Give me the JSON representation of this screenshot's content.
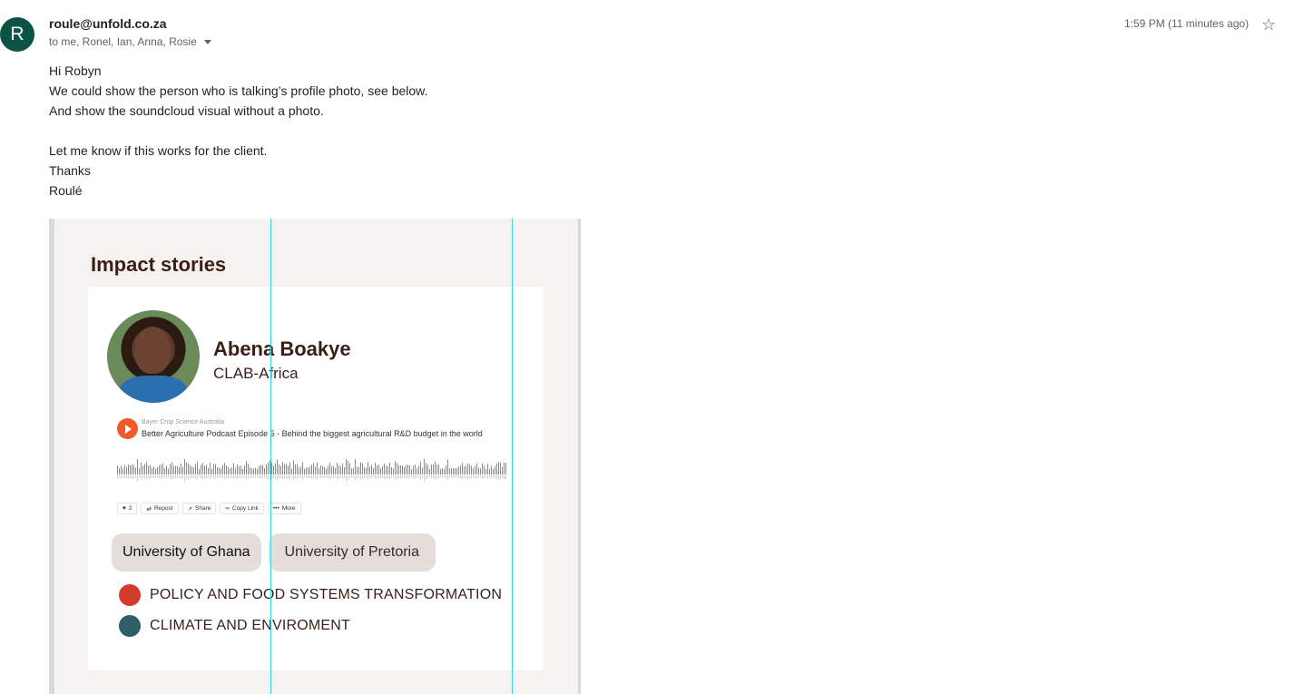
{
  "email": {
    "sender_initial": "R",
    "sender": "roule@unfold.co.za",
    "recipients": "to me, Ronel, Ian, Anna, Rosie",
    "timestamp": "1:59 PM (11 minutes ago)",
    "body_lines": [
      "Hi Robyn",
      "We could show the person who is talking’s profile photo, see below.",
      "And show the soundcloud visual without a photo.",
      "",
      "Let me know if this works for the client.",
      "Thanks",
      "Roulé"
    ]
  },
  "embed": {
    "title": "Impact stories",
    "person_name": "Abena Boakye",
    "person_org": "CLAB-Africa",
    "soundcloud": {
      "artist": "Bayer Crop Science Australia",
      "track": "Better Agriculture Podcast Episode 5 - Behind the biggest agricultural R&D budget in the world",
      "like_count": "2",
      "buttons": [
        "Repost",
        "Share",
        "Copy Link",
        "More"
      ]
    },
    "universities": [
      "University of Ghana",
      "University of Pretoria"
    ],
    "tags": [
      {
        "label": "POLICY AND FOOD SYSTEMS TRANSFORMATION",
        "color": "#d33a2c"
      },
      {
        "label": "CLIMATE AND ENVIROMENT",
        "color": "#2c5f66"
      }
    ]
  },
  "colors": {
    "avatar_bg": "#0b5345",
    "heading": "#3a1f17",
    "play_button": "#f15a24",
    "guide_line": "#34d6e0"
  }
}
